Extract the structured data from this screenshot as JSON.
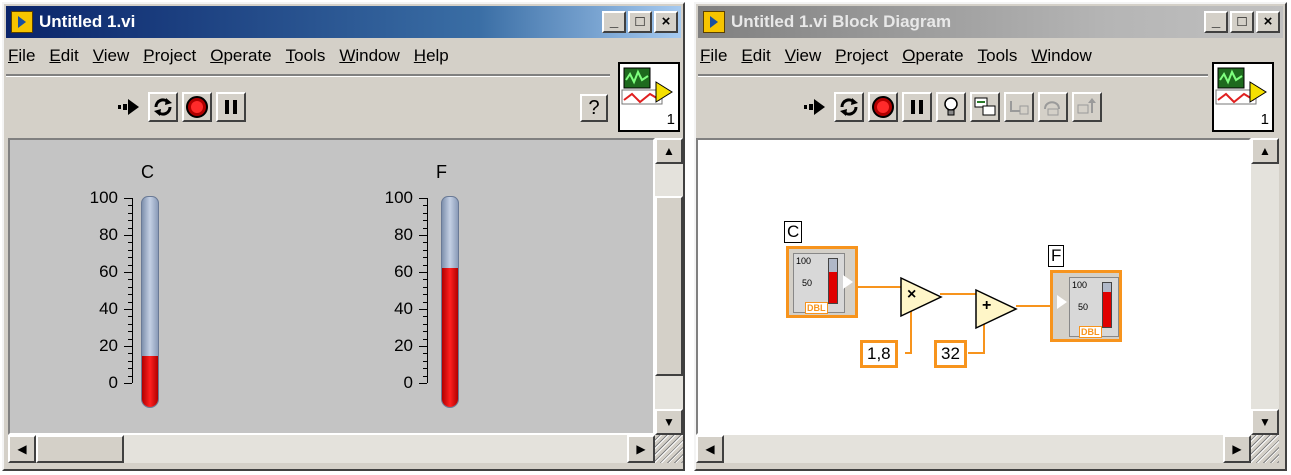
{
  "front_panel": {
    "title": "Untitled 1.vi",
    "menu": [
      {
        "ul": "F",
        "rest": "ile"
      },
      {
        "ul": "E",
        "rest": "dit"
      },
      {
        "ul": "V",
        "rest": "iew"
      },
      {
        "ul": "P",
        "rest": "roject"
      },
      {
        "ul": "O",
        "rest": "perate"
      },
      {
        "ul": "T",
        "rest": "ools"
      },
      {
        "ul": "W",
        "rest": "indow"
      },
      {
        "ul": "H",
        "rest": "elp"
      }
    ],
    "connector_number": "1",
    "help_glyph": "?",
    "thermometers": [
      {
        "label": "C",
        "value": 20
      },
      {
        "label": "F",
        "value": 68
      }
    ],
    "scale_ticks": [
      "100",
      "80",
      "60",
      "40",
      "20",
      "0"
    ]
  },
  "block_diagram": {
    "title": "Untitled 1.vi Block Diagram",
    "menu": [
      {
        "ul": "F",
        "rest": "ile"
      },
      {
        "ul": "E",
        "rest": "dit"
      },
      {
        "ul": "V",
        "rest": "iew"
      },
      {
        "ul": "P",
        "rest": "roject"
      },
      {
        "ul": "O",
        "rest": "perate"
      },
      {
        "ul": "T",
        "rest": "ools"
      },
      {
        "ul": "W",
        "rest": "indow"
      }
    ],
    "connector_number": "1",
    "input_label": "C",
    "output_label": "F",
    "multiply_constant": "1,8",
    "add_constant": "32",
    "multiply_glyph": "×",
    "add_glyph": "+",
    "terminal_type": "DBL",
    "terminal_scale_top": "100",
    "terminal_scale_mid": "50"
  },
  "window_controls": {
    "minimize": "_",
    "maximize": "□",
    "close": "×"
  },
  "colors": {
    "wire": "#f7941d",
    "title_active": "#0a246a",
    "title_inactive": "#808080",
    "fill": "#e00000"
  }
}
